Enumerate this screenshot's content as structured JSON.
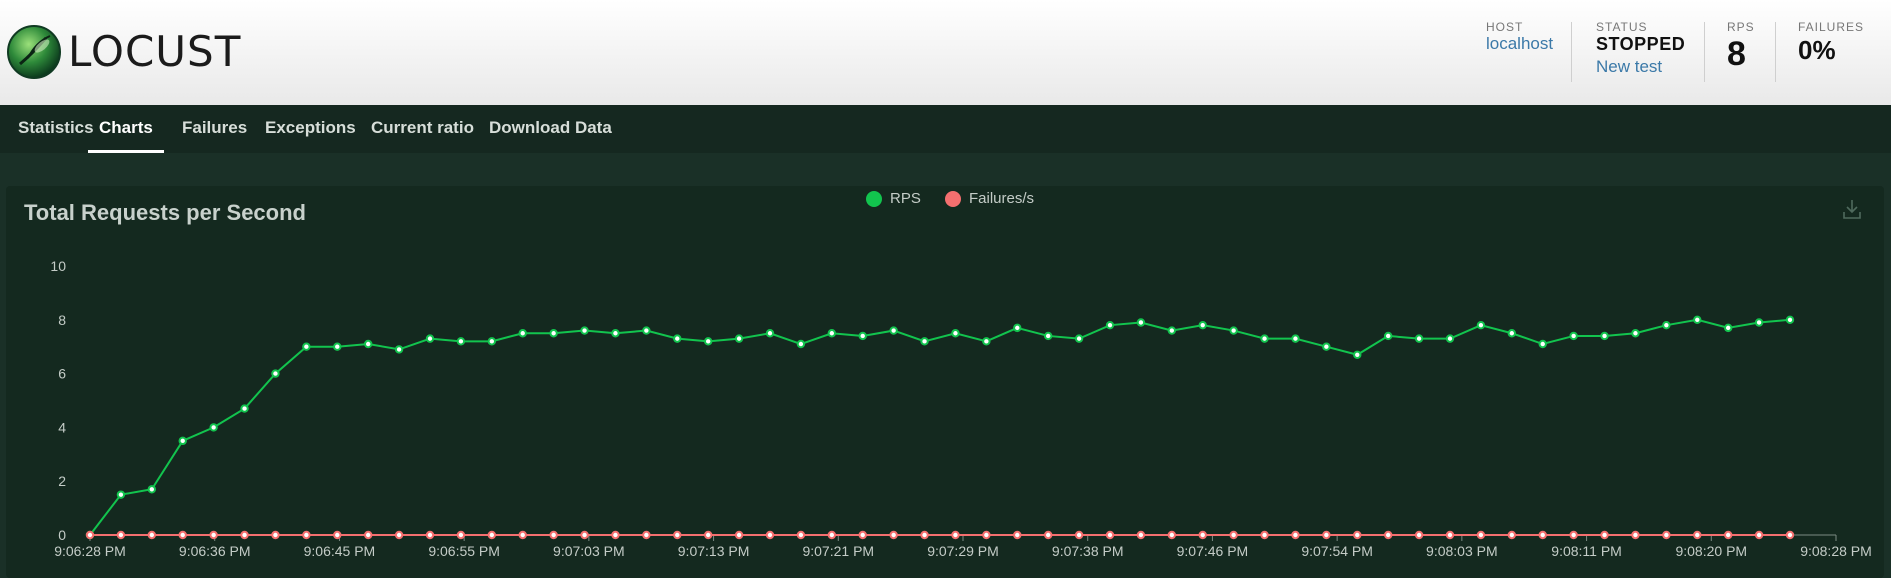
{
  "header": {
    "logo_text": "LOCUST",
    "host": {
      "label": "HOST",
      "value": "localhost"
    },
    "status": {
      "label": "STATUS",
      "value": "STOPPED",
      "link": "New test"
    },
    "rps": {
      "label": "RPS",
      "value": "8"
    },
    "failures": {
      "label": "FAILURES",
      "value": "0%"
    }
  },
  "nav": {
    "tabs": [
      {
        "label": "Statistics"
      },
      {
        "label": "Charts",
        "active": true
      },
      {
        "label": "Failures"
      },
      {
        "label": "Exceptions"
      },
      {
        "label": "Current ratio"
      },
      {
        "label": "Download Data"
      }
    ]
  },
  "colors": {
    "rps": "#12c44e",
    "failures": "#f46f6f",
    "background": "#1a3027",
    "panel": "#14291f"
  },
  "icons": {
    "download": "download-icon",
    "logo": "locust-logo-icon"
  },
  "chart_data": {
    "type": "line",
    "title": "Total Requests per Second",
    "legend": [
      "RPS",
      "Failures/s"
    ],
    "legend_placement": "top-center",
    "ylim": [
      0,
      10
    ],
    "yticks": [
      0,
      2,
      4,
      6,
      8,
      10
    ],
    "xtick_labels": [
      "9:06:28 PM",
      "9:06:36 PM",
      "9:06:45 PM",
      "9:06:55 PM",
      "9:07:03 PM",
      "9:07:13 PM",
      "9:07:21 PM",
      "9:07:29 PM",
      "9:07:38 PM",
      "9:07:46 PM",
      "9:07:54 PM",
      "9:08:03 PM",
      "9:08:11 PM",
      "9:08:20 PM",
      "9:08:28 PM"
    ],
    "grid": false,
    "series": [
      {
        "name": "RPS",
        "values": [
          0,
          1.5,
          1.7,
          3.5,
          4.0,
          4.7,
          6.0,
          7.0,
          7.0,
          7.1,
          6.9,
          7.3,
          7.2,
          7.2,
          7.5,
          7.5,
          7.6,
          7.5,
          7.6,
          7.3,
          7.2,
          7.3,
          7.5,
          7.1,
          7.5,
          7.4,
          7.6,
          7.2,
          7.5,
          7.2,
          7.7,
          7.4,
          7.3,
          7.8,
          7.9,
          7.6,
          7.8,
          7.6,
          7.3,
          7.3,
          7.0,
          6.7,
          7.4,
          7.3,
          7.3,
          7.8,
          7.5,
          7.1,
          7.4,
          7.4,
          7.5,
          7.8,
          8.0,
          7.7,
          7.9,
          8.0
        ]
      },
      {
        "name": "Failures/s",
        "values": [
          0,
          0,
          0,
          0,
          0,
          0,
          0,
          0,
          0,
          0,
          0,
          0,
          0,
          0,
          0,
          0,
          0,
          0,
          0,
          0,
          0,
          0,
          0,
          0,
          0,
          0,
          0,
          0,
          0,
          0,
          0,
          0,
          0,
          0,
          0,
          0,
          0,
          0,
          0,
          0,
          0,
          0,
          0,
          0,
          0,
          0,
          0,
          0,
          0,
          0,
          0,
          0,
          0,
          0,
          0,
          0
        ]
      }
    ]
  }
}
